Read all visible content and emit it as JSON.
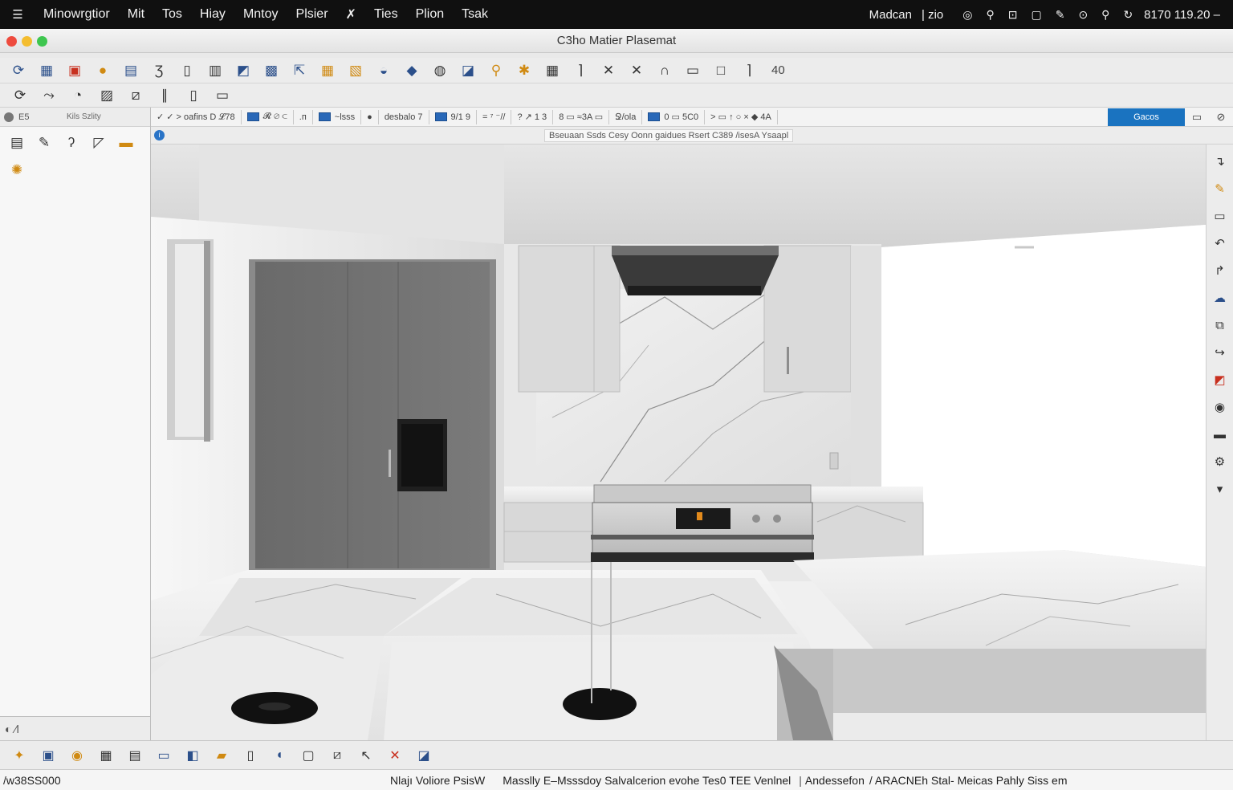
{
  "menubar": {
    "items": [
      "Minowrgtior",
      "Mit",
      "Tos",
      "Hiay",
      "Mntoy",
      "Plsier",
      "✗",
      "Ties",
      "Plion",
      "Tsak"
    ],
    "status_left": "Madcan",
    "status_mid": "| zio",
    "tray_icons": [
      "wifi-icon",
      "bike-icon",
      "device-icon",
      "window-icon",
      "edit-icon",
      "target-icon",
      "search-icon",
      "sync-icon"
    ],
    "clock": "8170 119.20",
    "dash": "–"
  },
  "window": {
    "title": "C3ho Matier Plasemat"
  },
  "toolbar_main": {
    "icons": [
      "orbit-icon",
      "grid-icon",
      "paint-icon",
      "sun-icon",
      "window-icon",
      "bracket-icon",
      "document-icon",
      "layers-icon",
      "landscape-icon",
      "save-icon",
      "export-icon",
      "calculator-icon",
      "materials-icon",
      "sphere-icon",
      "wedge-icon",
      "globe-icon",
      "flag-icon",
      "zoom-icon",
      "pin-icon",
      "calendar-icon",
      "corner-icon",
      "cross-icon",
      "cross-icon-2",
      "arc-icon",
      "rectangle-icon",
      "square-icon",
      "line-icon"
    ],
    "value": "40"
  },
  "toolbar_secondary": {
    "icons": [
      "orbit-icon",
      "walk-icon",
      "rotate-icon",
      "brush-icon",
      "slash-icon",
      "divider-icon",
      "panel-icon",
      "frame-icon"
    ]
  },
  "options_bar": {
    "segments": [
      "✓ ✓  > oafins D 𝓛78",
      "𝓡 ⌀ ⊂",
      ".п",
      "~lsss",
      "●",
      "desbalo 7",
      "9/1 9",
      "= ⁷ ⁻//",
      "? ↗ 1  3",
      "8 ▭ ≈3A ▭",
      "Ջ/ola",
      "0  ▭ 5C0",
      "> ▭ ↑ ○ ×  ◆ 4A"
    ],
    "active_button": "Gacos",
    "tail_icon": "▭",
    "end_icon": "⊘"
  },
  "info_bar": {
    "hint": "Bseuaan Ssds Cesy Oonn gaidues Rsert C389 /isesA Ysaapl"
  },
  "left_panel": {
    "tab_a": "E5",
    "tab_b": "Kils Szlity",
    "icons": [
      "list-icon",
      "paint-brush-icon",
      "hook-icon",
      "image-icon",
      "folder-icon",
      "wand-icon"
    ],
    "footer": "◐ ∕l"
  },
  "right_strip": {
    "icons": [
      "arrow-icon",
      "pencil-icon",
      "frame-icon",
      "undo-icon",
      "arrow-turn-icon",
      "cloud-icon",
      "copy-icon",
      "redirect-icon",
      "chart-icon",
      "camera-icon",
      "monitor-icon",
      "settings-icon",
      "dropdown-icon"
    ]
  },
  "bottom_toolbar": {
    "icons": [
      "tools-icon",
      "monitor-icon",
      "globe-icon",
      "grid-icon",
      "table-icon",
      "window-icon",
      "book-icon",
      "folder-icon",
      "document-icon",
      "bookmark-icon",
      "page-icon",
      "image-icon",
      "cursor-icon",
      "close-icon",
      "photo-icon"
    ]
  },
  "status_bar": {
    "coordinates": "/w38SS000",
    "items": [
      "Nlajı Voliore PsisW",
      "Masslly E–Msssdoy Salvalcerion evohe Tes0 TEE Venlnel",
      "Andessefon",
      "/ ARACNEh Stal- Meicas Pahly Siss em"
    ]
  },
  "colors": {
    "menubar_bg": "#101010",
    "close": "#ee4b3e",
    "minimize": "#f4bd2f",
    "maximize": "#3ec64f",
    "accent": "#1a73c0"
  }
}
